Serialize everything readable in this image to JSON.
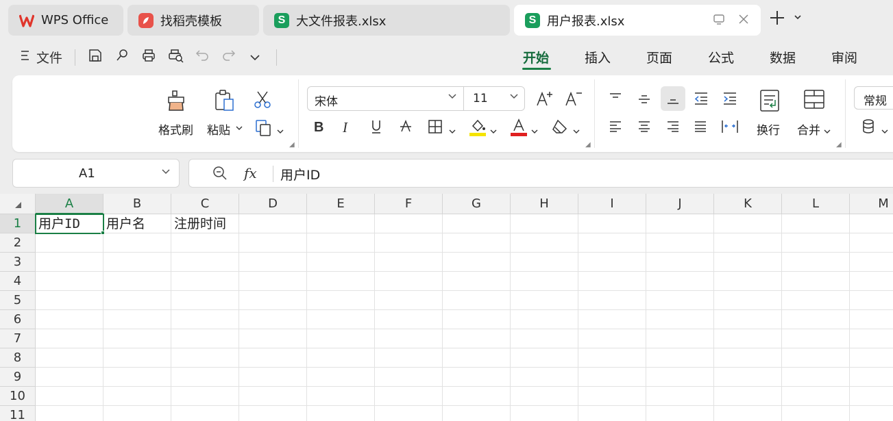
{
  "tabs": [
    {
      "label": "WPS Office",
      "icon": "wps-logo-icon",
      "active": false
    },
    {
      "label": "找稻壳模板",
      "icon": "daoke-logo-icon",
      "active": false
    },
    {
      "label": "大文件报表.xlsx",
      "icon": "spreadsheet-file-icon",
      "active": false
    },
    {
      "label": "用户报表.xlsx",
      "icon": "spreadsheet-file-icon",
      "active": true
    }
  ],
  "tab_icon_letters": {
    "sheet": "S"
  },
  "quick": {
    "file_label": "文件"
  },
  "menu_tabs": [
    "开始",
    "插入",
    "页面",
    "公式",
    "数据",
    "审阅"
  ],
  "ribbon": {
    "format_painter": "格式刷",
    "paste": "粘贴",
    "font_name": "宋体",
    "font_size": "11",
    "wrap": "换行",
    "merge": "合并",
    "number_format": "常规"
  },
  "formula": {
    "cell_ref": "A1",
    "fx": "fx",
    "value": "用户ID"
  },
  "sheet": {
    "columns": [
      "A",
      "B",
      "C",
      "D",
      "E",
      "F",
      "G",
      "H",
      "I",
      "J",
      "K",
      "L",
      "M"
    ],
    "rows": [
      "1",
      "2",
      "3",
      "4",
      "5",
      "6",
      "7",
      "8",
      "9",
      "10",
      "11"
    ],
    "cells": {
      "A1": "用户ID",
      "B1": "用户名",
      "C1": "注册时间"
    },
    "active_cell": "A1"
  },
  "colors": {
    "accent": "#1a7f45",
    "highlight": "#f5e400",
    "font_color": "#e02020",
    "sheet_icon": "#1a9e5c"
  }
}
